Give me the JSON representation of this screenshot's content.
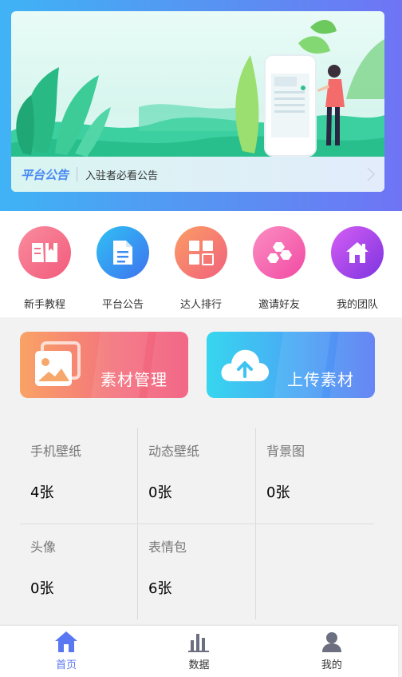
{
  "banner": {
    "notice_logo": "平台公告",
    "notice_text": "入驻者必看公告"
  },
  "shortcuts": [
    {
      "label": "新手教程",
      "icon": "book-icon",
      "color_from": "#f98c9e",
      "color_to": "#f25b7b"
    },
    {
      "label": "平台公告",
      "icon": "document-icon",
      "color_from": "#2fc1f3",
      "color_to": "#3f72f0"
    },
    {
      "label": "达人排行",
      "icon": "grid-icon",
      "color_from": "#fb9d63",
      "color_to": "#f1617e"
    },
    {
      "label": "邀请好友",
      "icon": "hexagons-icon",
      "color_from": "#fb8ec2",
      "color_to": "#f14aa3"
    },
    {
      "label": "我的团队",
      "icon": "home-icon",
      "color_from": "#d65ef4",
      "color_to": "#7c34e0"
    }
  ],
  "cards": {
    "left": {
      "label": "素材管理",
      "icon": "image-icon"
    },
    "right": {
      "label": "上传素材",
      "icon": "cloud-upload-icon"
    }
  },
  "stats": [
    {
      "name": "手机壁纸",
      "value": "4张"
    },
    {
      "name": "动态壁纸",
      "value": "0张"
    },
    {
      "name": "背景图",
      "value": "0张"
    },
    {
      "name": "头像",
      "value": "0张"
    },
    {
      "name": "表情包",
      "value": "6张"
    }
  ],
  "tabs": [
    {
      "label": "首页",
      "icon": "home-icon",
      "active": true
    },
    {
      "label": "数据",
      "icon": "bar-chart-icon",
      "active": false
    },
    {
      "label": "我的",
      "icon": "user-icon",
      "active": false
    }
  ],
  "colors": {
    "accent": "#5a77f2",
    "header_from": "#3fb3f5",
    "header_to": "#6f74f5"
  }
}
